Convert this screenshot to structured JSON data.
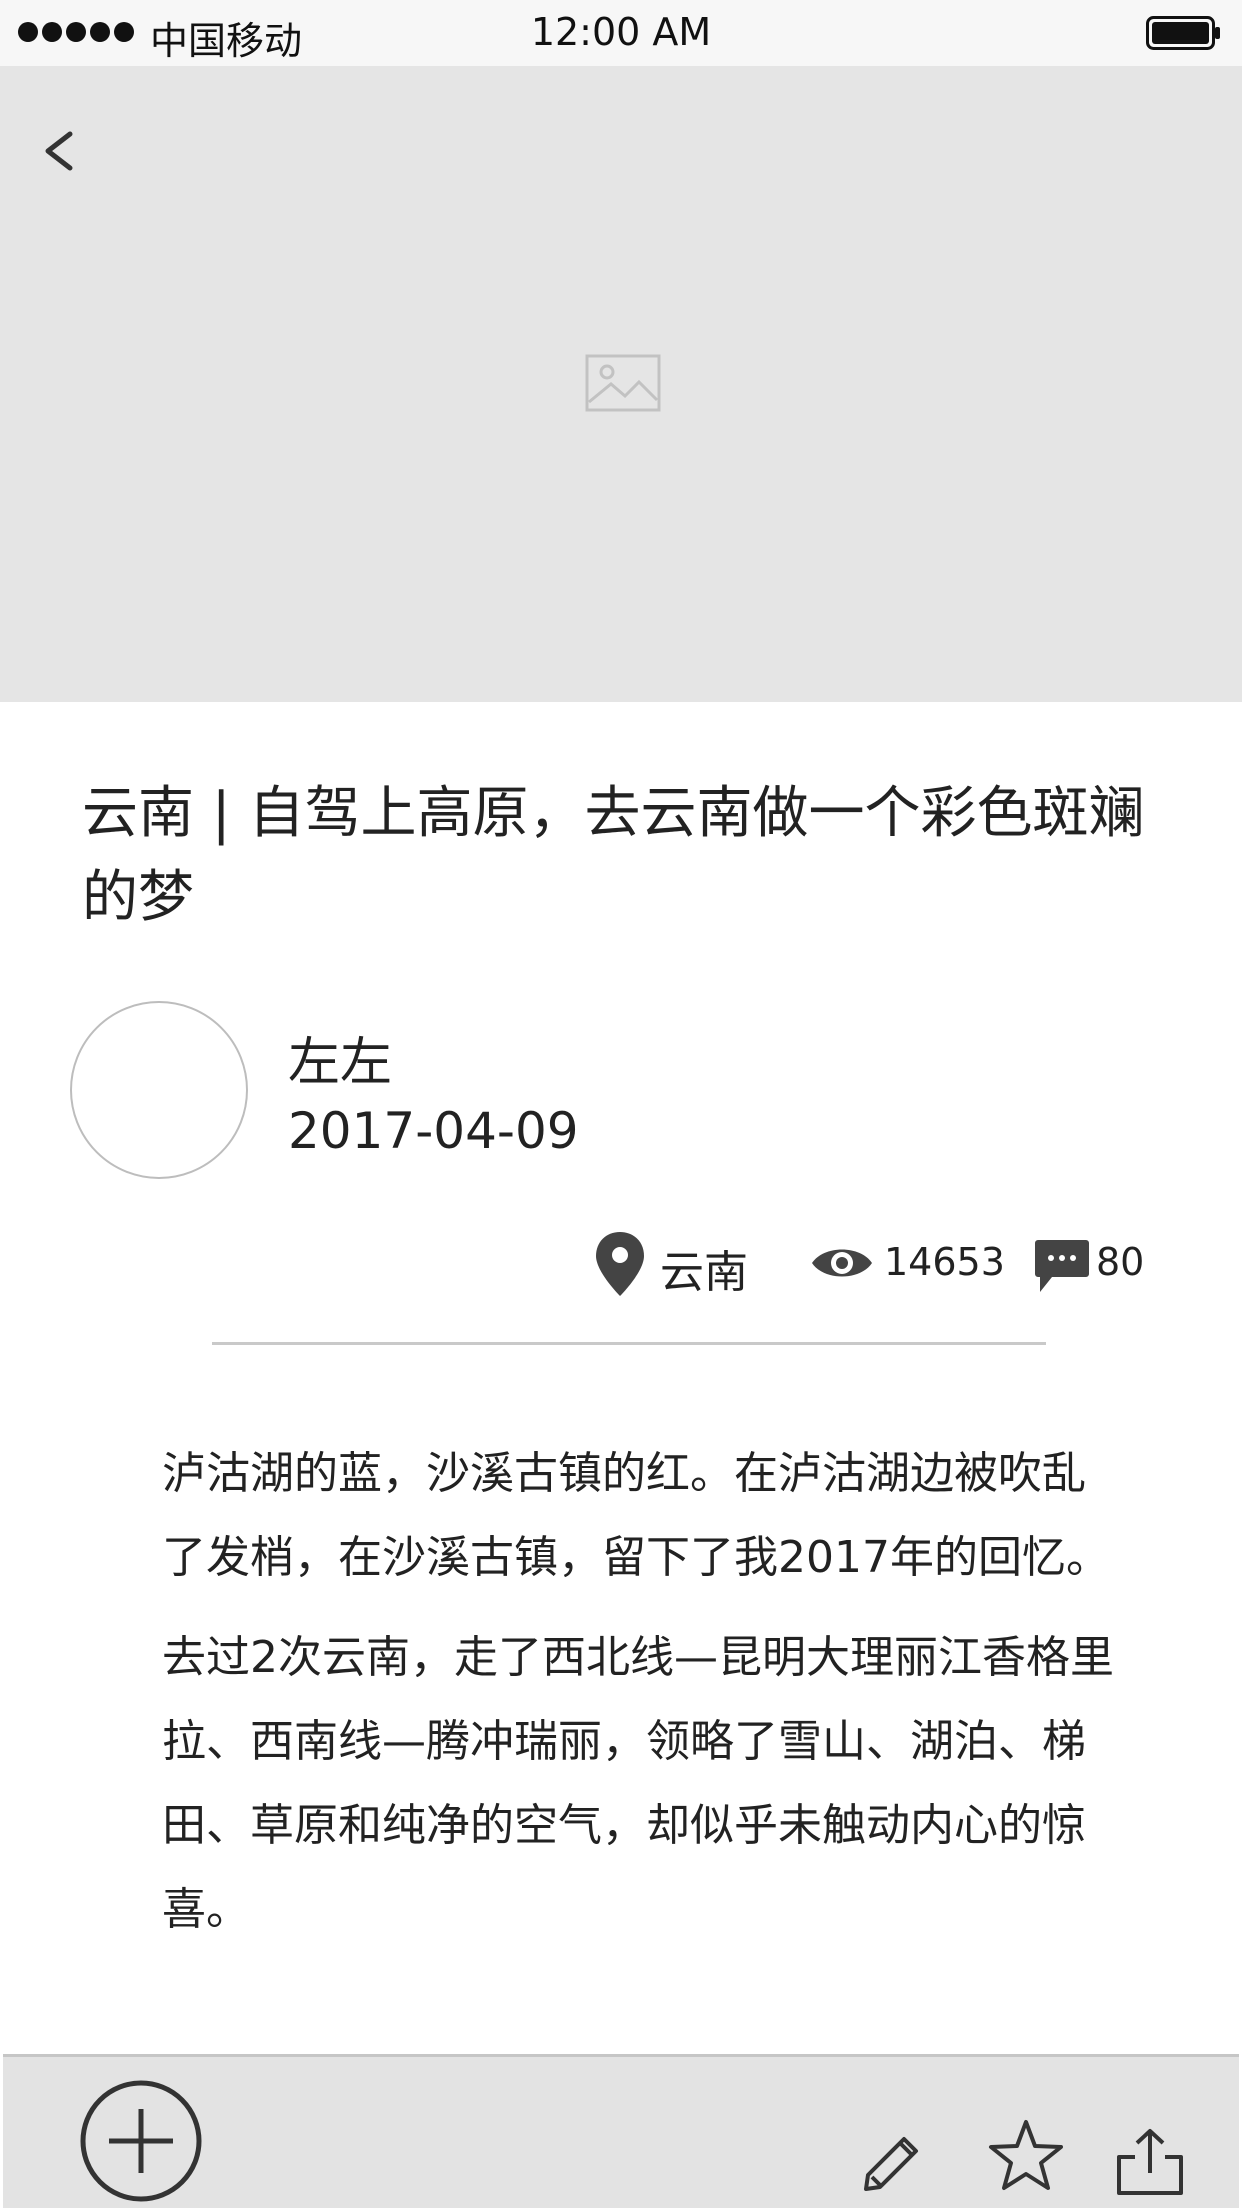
{
  "status_bar": {
    "carrier": "中国移动",
    "time": "12:00 AM"
  },
  "hero": {
    "back_icon": "chevron-left-icon",
    "placeholder_icon": "image-icon"
  },
  "article": {
    "title": "云南 | 自驾上高原，去云南做一个彩色斑斓的梦",
    "author": "左左",
    "date": "2017-04-09",
    "location": "云南",
    "views": "14653",
    "comments": "80",
    "paragraphs": [
      "泸沽湖的蓝，沙溪古镇的红。在泸沽湖边被吹乱了发梢，在沙溪古镇，留下了我2017年的回忆。",
      "去过2次云南，走了西北线—昆明大理丽江香格里拉、西南线—腾冲瑞丽，领略了雪山、湖泊、梯田、草原和纯净的空气，却似乎未触动内心的惊喜。"
    ]
  },
  "toolbar": {
    "icons": [
      "plus-circle-icon",
      "pencil-icon",
      "star-icon",
      "share-icon"
    ]
  },
  "colors": {
    "hero_bg": "#e5e5e5",
    "toolbar_bg": "#e3e3e3",
    "text": "#222222",
    "divider": "#c9c9c9"
  }
}
